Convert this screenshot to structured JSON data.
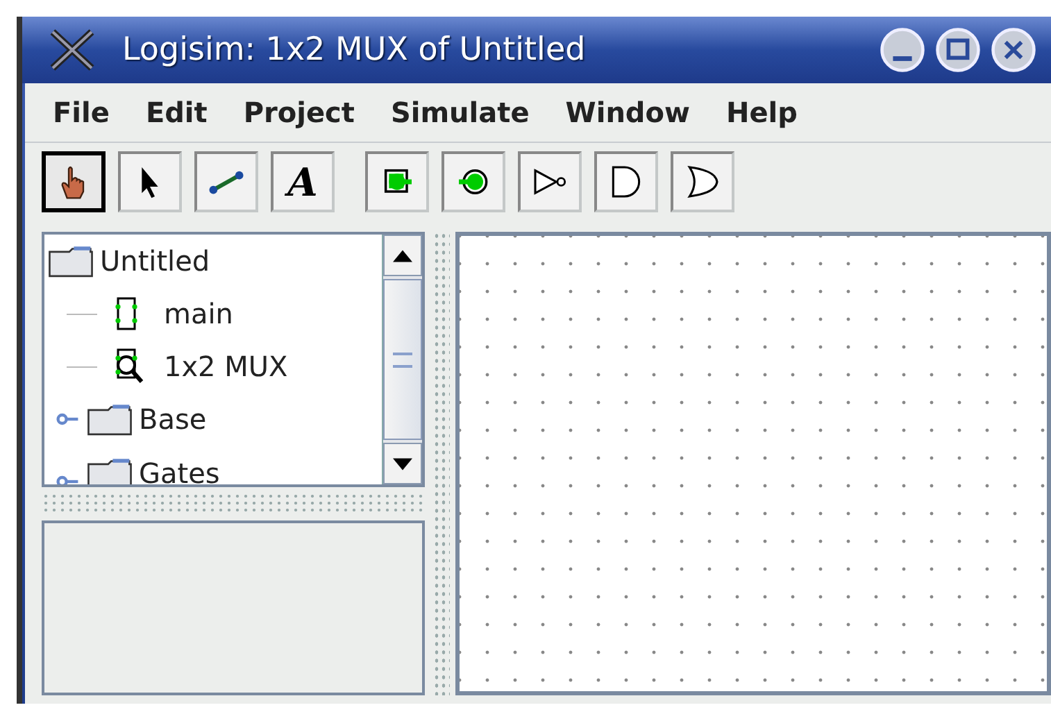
{
  "window": {
    "title": "Logisim: 1x2 MUX of Untitled"
  },
  "menu": [
    "File",
    "Edit",
    "Project",
    "Simulate",
    "Window",
    "Help"
  ],
  "tools": [
    {
      "kind": "poke",
      "selected": true
    },
    {
      "kind": "select",
      "selected": false
    },
    {
      "kind": "wire",
      "selected": false
    },
    {
      "kind": "text",
      "selected": false,
      "glyph": "A"
    },
    {
      "kind": "pin-in",
      "selected": false
    },
    {
      "kind": "pin-out",
      "selected": false
    },
    {
      "kind": "not",
      "selected": false
    },
    {
      "kind": "and",
      "selected": false
    },
    {
      "kind": "or",
      "selected": false
    }
  ],
  "tree": [
    {
      "label": "Untitled",
      "children": [
        {
          "label": "main",
          "kind": "circuit"
        },
        {
          "label": "1x2 MUX",
          "kind": "current-circuit"
        }
      ]
    },
    {
      "label": "Base",
      "expanded": false
    },
    {
      "label": "Gates",
      "expanded": false
    }
  ]
}
